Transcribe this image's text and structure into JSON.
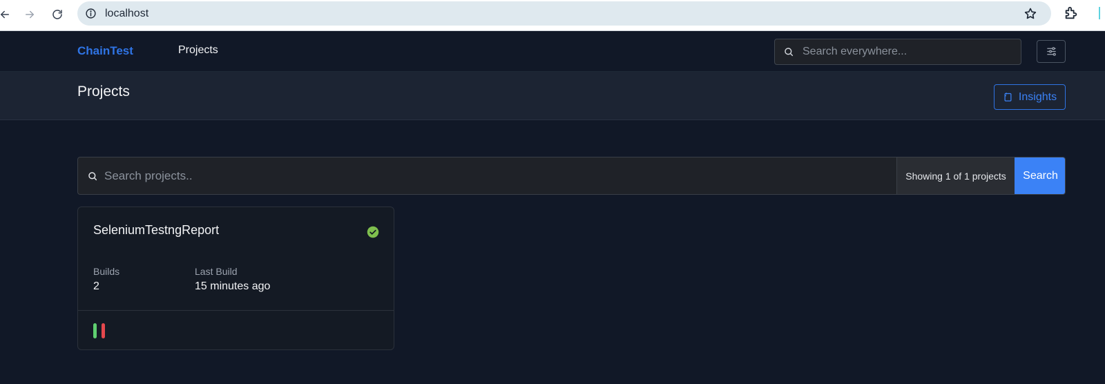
{
  "browser": {
    "url": "localhost",
    "icons": [
      "back-arrow-icon",
      "forward-arrow-icon",
      "reload-icon",
      "site-info-icon",
      "bookmark-star-icon",
      "extensions-icon"
    ]
  },
  "navbar": {
    "brand": "ChainTest",
    "nav_projects": "Projects",
    "search_placeholder": "Search everywhere...",
    "accent_color": "#2f74e5"
  },
  "header": {
    "title": "Projects",
    "insights_label": "Insights"
  },
  "project_search": {
    "placeholder": "Search projects..",
    "showing_text": "Showing 1 of 1 projects",
    "search_button": "Search",
    "button_color": "#3b82f6"
  },
  "projects": [
    {
      "name": "SeleniumTestngReport",
      "status": "passed",
      "status_color": "#7fbf4e",
      "builds_label": "Builds",
      "builds_value": "2",
      "last_build_label": "Last Build",
      "last_build_value": "15 minutes ago",
      "build_history": [
        {
          "result": "passed",
          "color": "#5fcf70"
        },
        {
          "result": "failed",
          "color": "#e5484d"
        }
      ]
    }
  ]
}
